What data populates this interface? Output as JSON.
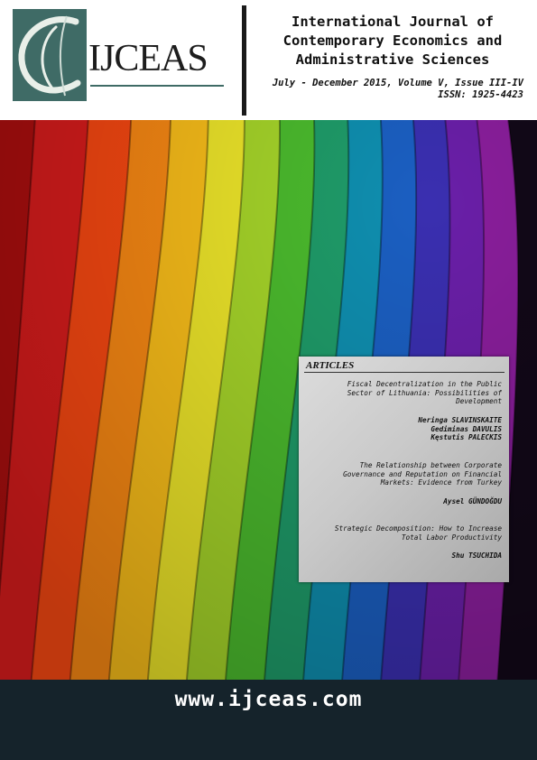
{
  "logo": {
    "text": "IJCEAS",
    "colors": {
      "box": "#3f6b66",
      "text": "#1d1d1d"
    }
  },
  "journal": {
    "title_lines": [
      "International Journal of",
      "Contemporary Economics and",
      "Administrative Sciences"
    ],
    "issue_line": "July - December 2015, Volume V, Issue III-IV",
    "issn_line": "ISSN: 1925-4423"
  },
  "articles": {
    "heading": "ARTICLES",
    "items": [
      {
        "title_lines": [
          "Fiscal Decentralization in the Public",
          "Sector of Lithuania: Possibilities of",
          "Development"
        ],
        "author_lines": [
          "Neringa SLAVINSKAITE",
          "Gediminas DAVULIS",
          "Kęstutis PALECKIS"
        ]
      },
      {
        "title_lines": [
          "The Relationship between Corporate",
          "Governance and Reputation on Financial",
          "Markets: Evidence from Turkey"
        ],
        "author_lines": [
          "Aysel GÜNDOĞDU"
        ]
      },
      {
        "title_lines": [
          "Strategic Decomposition: How to Increase",
          "Total Labor Productivity"
        ],
        "author_lines": [
          "Shu TSUCHIDA"
        ]
      }
    ]
  },
  "footer": {
    "url": "www.ijceas.com",
    "background": "#15232b"
  },
  "art_palette": [
    "#b30f0f",
    "#e01d1d",
    "#ff4a12",
    "#ff8c14",
    "#ffc21a",
    "#f2ea2a",
    "#a8d82a",
    "#4cbd2e",
    "#1f9d6a",
    "#0f8fb0",
    "#1b5fc2",
    "#3a2fb0",
    "#6a1fa8",
    "#8a1e9c"
  ]
}
